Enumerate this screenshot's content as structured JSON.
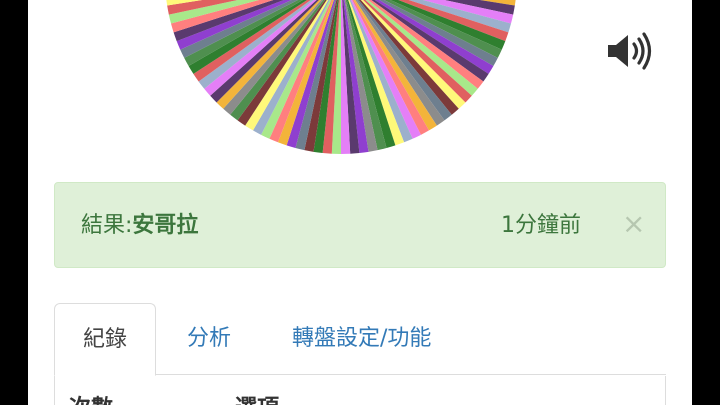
{
  "wheel": {
    "colors": [
      "#ff7f7f",
      "#fff97a",
      "#8c8c8c",
      "#e47ff7",
      "#2f7f2f",
      "#8f3fcf",
      "#a8e88a",
      "#7c3a3a",
      "#f3b43a",
      "#9cb0cc",
      "#4f8f4f",
      "#5a3a6e",
      "#e06060",
      "#6e7f8f"
    ]
  },
  "speaker": {
    "icon": "volume-icon"
  },
  "alert": {
    "label": "結果:",
    "value": "安哥拉",
    "time": "1分鐘前",
    "close": "×"
  },
  "tabs": [
    {
      "label": "紀錄",
      "active": true
    },
    {
      "label": "分析",
      "active": false
    },
    {
      "label": "轉盤設定/功能",
      "active": false
    }
  ],
  "table": {
    "headers": [
      "次數",
      "選項"
    ]
  }
}
